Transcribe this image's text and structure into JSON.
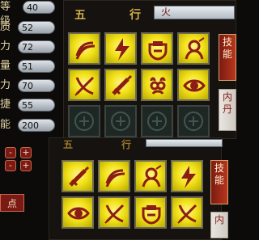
{
  "stats": [
    {
      "label": "等级",
      "value": "40"
    },
    {
      "label": "质",
      "value": "52"
    },
    {
      "label": "力",
      "value": "72"
    },
    {
      "label": "量",
      "value": "51"
    },
    {
      "label": "力",
      "value": "70"
    },
    {
      "label": "捷",
      "value": "55"
    },
    {
      "label": "能",
      "value": "200"
    }
  ],
  "top_panel": {
    "wuxing_label_1": "五",
    "wuxing_label_2": "行",
    "element_value": "火"
  },
  "side_tabs_top": [
    {
      "label": "技\n能"
    },
    {
      "label": "内\n丹"
    }
  ],
  "side_tabs_bottom": [
    {
      "label": "技\n能"
    },
    {
      "label": "内"
    }
  ],
  "lower_header": {
    "left_partial": "五",
    "right_partial": "行"
  },
  "left_misc": {
    "partial_text": "点"
  },
  "icons": {
    "top_grid": [
      [
        "claw-icon",
        "lightning-icon",
        "armor-icon",
        "spirit-icon"
      ],
      [
        "bow-icon",
        "sword-icon",
        "owl-icon",
        "eye-icon"
      ],
      [
        "empty-slot",
        "empty-slot",
        "empty-slot",
        "empty-slot"
      ]
    ],
    "bottom_grid": [
      [
        "sword-icon",
        "claw-icon",
        "spirit-icon",
        "lightning-icon"
      ],
      [
        "eye-icon",
        "bow-icon",
        "armor-icon",
        "bow-icon"
      ]
    ]
  },
  "colors": {
    "skill_bg": "#f2e21a",
    "skill_icon": "#8b1d12",
    "accent_red": "#7b1a14"
  }
}
